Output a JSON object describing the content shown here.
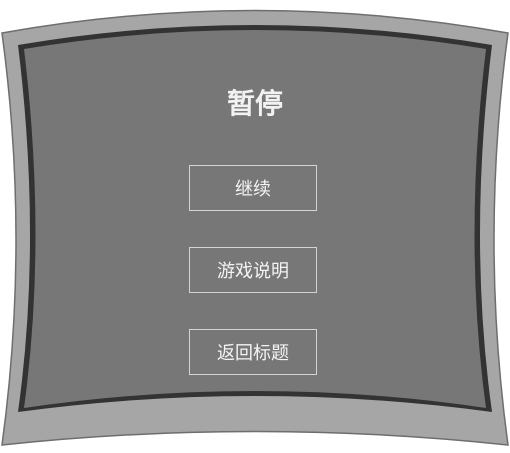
{
  "pause_menu": {
    "title": "暂停",
    "buttons": {
      "resume": "继续",
      "help": "游戏说明",
      "return_title": "返回标题"
    }
  },
  "colors": {
    "outer_border": "#a6a6a6",
    "dark_rim": "#333333",
    "panel_fill": "#777777",
    "text": "#f2f2f2",
    "button_border": "#d4d4d4"
  }
}
